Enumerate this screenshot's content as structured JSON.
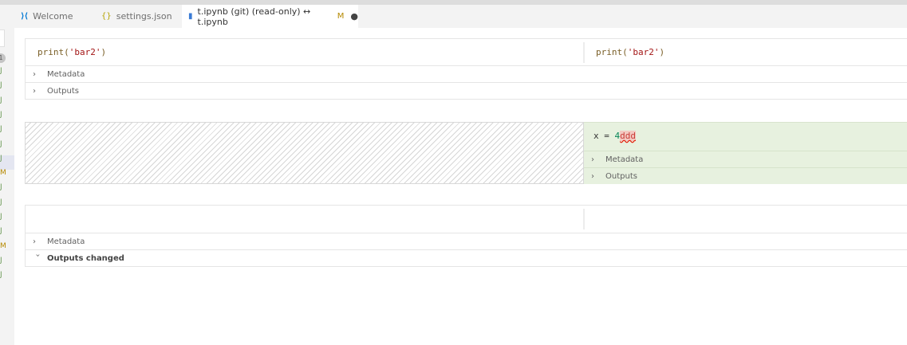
{
  "window": {
    "tabs": [
      {
        "label": "Welcome",
        "icon": "vscode-logo-icon",
        "active": false
      },
      {
        "label": "settings.json",
        "icon": "json-braces-icon",
        "active": false
      },
      {
        "label": "t.ipynb (git) (read-only) ↔ t.ipynb",
        "icon": "notebook-icon",
        "status": "M",
        "active": true,
        "dirty": true
      }
    ]
  },
  "gutter": {
    "badge": "1",
    "letters": [
      "J",
      "J",
      "J",
      "J",
      "J",
      "J",
      "J",
      "M",
      "J",
      "J",
      "J",
      "J",
      "M",
      "J",
      "J"
    ],
    "colors": {
      "u": "#6a9955",
      "m": "#b58900"
    }
  },
  "diff": {
    "cell1": {
      "left_code": {
        "fn": "print(",
        "str": "'bar2'",
        "close": ")"
      },
      "right_code": {
        "fn": "print(",
        "str": "'bar2'",
        "close": ")"
      },
      "metadata_label": "Metadata",
      "outputs_label": "Outputs"
    },
    "cell2": {
      "code": {
        "var": "x = ",
        "num": "4",
        "err": "ddd"
      },
      "metadata_label": "Metadata",
      "outputs_label": "Outputs"
    },
    "cell3": {
      "metadata_label": "Metadata",
      "outputs_label": "Outputs changed"
    }
  },
  "colors": {
    "added_bg": "#e7f1df",
    "string": "#a31515",
    "function": "#795e26"
  }
}
